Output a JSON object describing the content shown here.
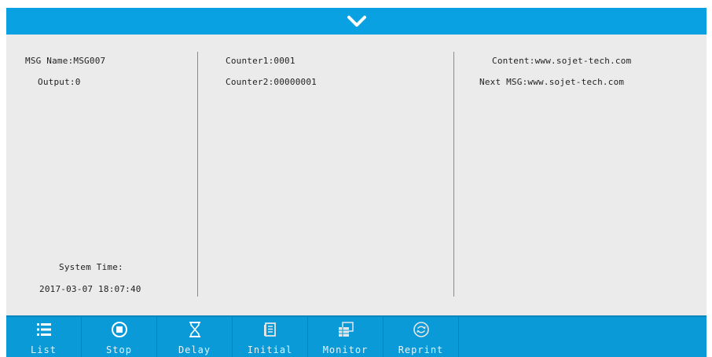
{
  "colors": {
    "accent_bar": "#0aa1e2",
    "toolbar": "#0b9ad8",
    "panel": "#ebebeb"
  },
  "header": {
    "icon": "chevron-down-icon"
  },
  "left": {
    "msg_name": "MSG Name:MSG007",
    "output": "Output:0",
    "system_time_label": "System Time:",
    "system_time_value": "2017-03-07 18:07:40"
  },
  "middle": {
    "counter1": "Counter1:0001",
    "counter2": "Counter2:00000001"
  },
  "right": {
    "content": "Content:www.sojet-tech.com",
    "next_msg": "Next MSG:www.sojet-tech.com"
  },
  "toolbar": {
    "items": [
      {
        "label": "List",
        "icon": "list-icon"
      },
      {
        "label": "Stop",
        "icon": "stop-icon"
      },
      {
        "label": "Delay",
        "icon": "hourglass-icon"
      },
      {
        "label": "Initial",
        "icon": "document-icon"
      },
      {
        "label": "Monitor",
        "icon": "monitor-icon"
      },
      {
        "label": "Reprint",
        "icon": "reprint-icon"
      }
    ]
  }
}
